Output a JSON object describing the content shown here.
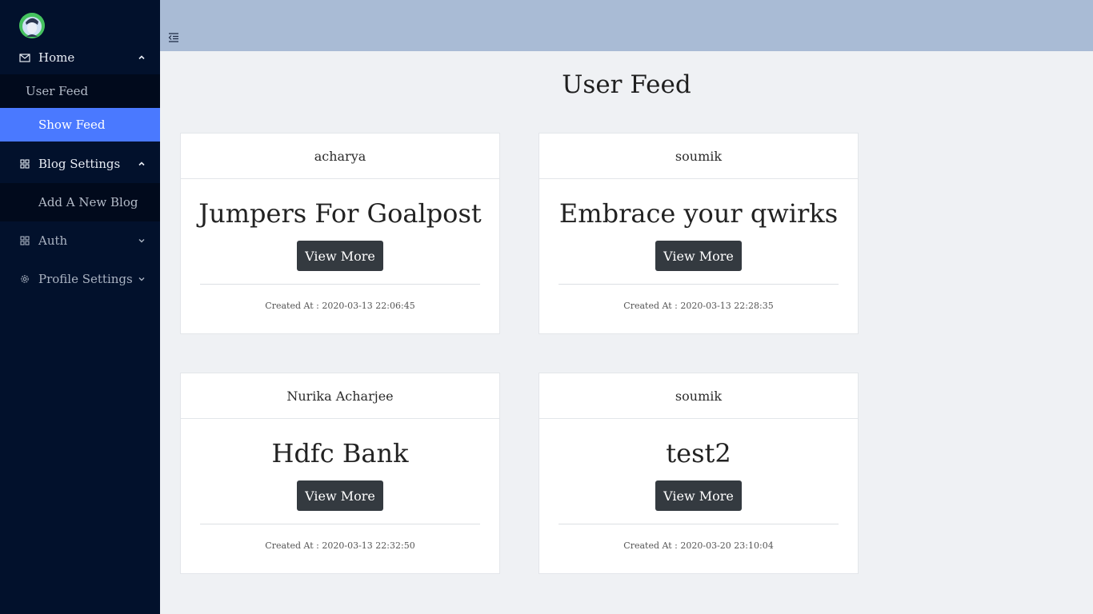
{
  "sidebar": {
    "menu": {
      "home": {
        "label": "Home",
        "icon": "mail-icon"
      },
      "blog_settings": {
        "label": "Blog Settings",
        "icon": "grid-icon"
      },
      "auth": {
        "label": "Auth",
        "icon": "grid-icon"
      },
      "profile_settings": {
        "label": "Profile Settings",
        "icon": "gear-icon"
      }
    },
    "home_sub": [
      "User Feed",
      "Show Feed"
    ],
    "blog_sub": [
      "Add A New Blog"
    ],
    "active_color": "#4a79ff"
  },
  "page": {
    "title": "User Feed"
  },
  "cards": [
    {
      "author": "acharya",
      "title": "Jumpers For Goalpost",
      "button": "View More",
      "created": "Created At : 2020-03-13 22:06:45"
    },
    {
      "author": "soumik",
      "title": "Embrace your qwirks",
      "button": "View More",
      "created": "Created At : 2020-03-13 22:28:35"
    },
    {
      "author": "Nurika Acharjee",
      "title": "Hdfc Bank",
      "button": "View More",
      "created": "Created At : 2020-03-13 22:32:50"
    },
    {
      "author": "soumik",
      "title": "test2",
      "button": "View More",
      "created": "Created At : 2020-03-20 23:10:04"
    }
  ]
}
